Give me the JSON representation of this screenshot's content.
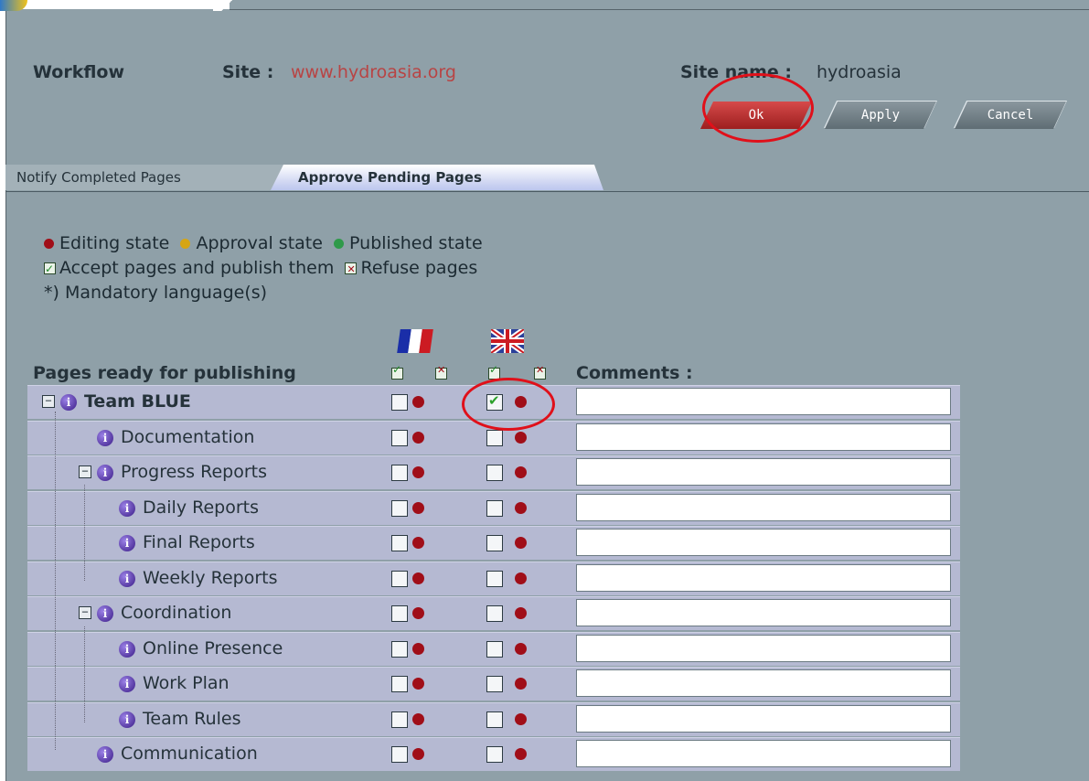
{
  "header": {
    "workflow_label": "Workflow",
    "site_label": "Site :",
    "site_url": "www.hydroasia.org",
    "site_name_label": "Site name :",
    "site_name": "hydroasia"
  },
  "buttons": {
    "ok": "Ok",
    "apply": "Apply",
    "cancel": "Cancel"
  },
  "tabs": [
    {
      "label": "Notify Completed Pages",
      "active": false
    },
    {
      "label": "Approve Pending Pages",
      "active": true
    }
  ],
  "legend": {
    "editing": "Editing state",
    "approval": "Approval state",
    "published": "Published state",
    "accept": "Accept pages and publish them",
    "refuse": "Refuse pages",
    "mandatory": "*) Mandatory language(s)"
  },
  "table": {
    "pages_header": "Pages ready for publishing",
    "comments_header": "Comments :",
    "rows": [
      {
        "label": "Team BLUE",
        "fr_checked": false,
        "en_checked": true
      },
      {
        "label": "Documentation",
        "fr_checked": false,
        "en_checked": false
      },
      {
        "label": "Progress Reports",
        "fr_checked": false,
        "en_checked": false
      },
      {
        "label": "Daily Reports",
        "fr_checked": false,
        "en_checked": false
      },
      {
        "label": "Final Reports",
        "fr_checked": false,
        "en_checked": false
      },
      {
        "label": "Weekly Reports",
        "fr_checked": false,
        "en_checked": false
      },
      {
        "label": "Coordination",
        "fr_checked": false,
        "en_checked": false
      },
      {
        "label": "Online Presence",
        "fr_checked": false,
        "en_checked": false
      },
      {
        "label": "Work Plan",
        "fr_checked": false,
        "en_checked": false
      },
      {
        "label": "Team Rules",
        "fr_checked": false,
        "en_checked": false
      },
      {
        "label": "Communication",
        "fr_checked": false,
        "en_checked": false
      }
    ]
  },
  "colors": {
    "panel": "#8fa0a8",
    "row": "#b5b9d2",
    "accent_red": "#e0101a"
  },
  "icons": [
    "info-icon",
    "expand-collapse-icon",
    "flag-fr-icon",
    "flag-uk-icon",
    "accept-icon",
    "refuse-icon"
  ]
}
